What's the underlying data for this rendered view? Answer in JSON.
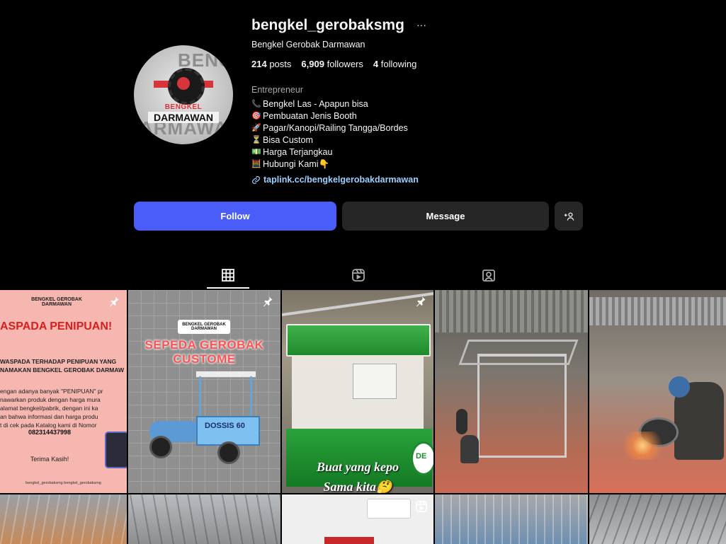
{
  "profile": {
    "username": "bengkel_gerobaksmg",
    "more_icon": "···",
    "full_name": "Bengkel Gerobak Darmawan",
    "avatar_text": {
      "bg_top": "BENG",
      "bg_bottom": "ARMAWA",
      "brand_line1": "BENGKEL GEROBAK",
      "brand_line2": "DARMAWAN"
    },
    "stats": {
      "posts_count": "214",
      "posts_label": "posts",
      "followers_count": "6,909",
      "followers_label": "followers",
      "following_count": "4",
      "following_label": "following"
    },
    "category": "Entrepreneur",
    "bio": [
      {
        "icon": "phone-icon",
        "glyph": "📞",
        "text": "Bengkel Las - Apapun bisa"
      },
      {
        "icon": "target-icon",
        "glyph": "🎯",
        "text": "Pembuatan Jenis Booth"
      },
      {
        "icon": "rocket-icon",
        "glyph": "🚀",
        "text": " Pagar/Kanopi/Railing Tangga/Bordes"
      },
      {
        "icon": "hourglass-icon",
        "glyph": "⏳",
        "text": "Bisa Custom"
      },
      {
        "icon": "money-icon",
        "glyph": "💵",
        "text": "Harga Terjangkau"
      },
      {
        "icon": "calculator-icon",
        "glyph": "🧮",
        "text": "Hubungi Kami👇"
      }
    ],
    "link": "taplink.cc/bengkelgerobakdarmawan"
  },
  "actions": {
    "follow_label": "Follow",
    "message_label": "Message",
    "add_user_label": "+♙"
  },
  "tabs": [
    {
      "name": "posts",
      "icon": "grid-icon",
      "active": true
    },
    {
      "name": "reels",
      "icon": "reels-icon",
      "active": false
    },
    {
      "name": "tagged",
      "icon": "tagged-icon",
      "active": false
    }
  ],
  "posts": {
    "post1": {
      "logo": "BENGKEL GEROBAK DARMAWAN",
      "heading": "ASPADA PENIPUAN!",
      "line1": "WASPADA TERHADAP PENIPUAN YANG",
      "line2": "NAMAKAN BENGKEL GEROBAK DARMAW",
      "body1": "engan adanya banyak \"PENIPUAN\" pr",
      "body2": "nawarkan produk dengan harga mura",
      "body3": "alamat bengkel/pabrik, dengan ini ka",
      "body4": "an bahwa informasi dan harga produ",
      "body5": "t di cek pada Katalog kami di Nomor",
      "phone": "082314437998",
      "thanks": "Terima Kasih!",
      "footer": "bengkel_gerobaksmg   bengkel_gerobaksmg"
    },
    "post2": {
      "logo": "BENGKEL GEROBAK DARMAWAN",
      "title1": "sepeda gerobak",
      "title2": "custome",
      "cart_label": "DOSSIS 60"
    },
    "post3": {
      "caption1": "Buat yang kepo",
      "caption2": "Sama kita🤔",
      "cart_text": "DE"
    },
    "post4": {},
    "post5": {}
  },
  "colors": {
    "accent": "#4a5df9",
    "secondary_button": "#262626",
    "link": "#9bd0ff",
    "brand_red": "#d8353a"
  }
}
